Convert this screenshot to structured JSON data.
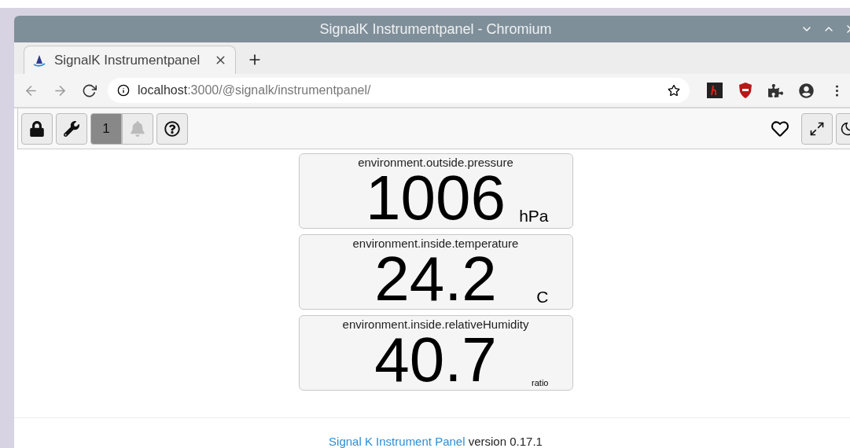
{
  "window": {
    "title": "SignalK Instrumentpanel - Chromium"
  },
  "tabs": [
    {
      "label": "SignalK Instrumentpanel",
      "selected": true
    }
  ],
  "address_bar": {
    "host": "localhost",
    "path": ":3000/@signalk/instrumentpanel/"
  },
  "toolbar": {
    "page_button": {
      "label": "1",
      "selected": true
    },
    "notifications": {
      "disabled": true
    }
  },
  "instruments": [
    {
      "title": "environment.outside.pressure",
      "value": "1006",
      "unit": "hPa"
    },
    {
      "title": "environment.inside.temperature",
      "value": "24.2",
      "unit": "C"
    },
    {
      "title": "environment.inside.relativeHumidity",
      "value": "40.7",
      "unit": "ratio"
    }
  ],
  "footer": {
    "link": "Signal K Instrument Panel",
    "text": "version 0.17.1"
  }
}
